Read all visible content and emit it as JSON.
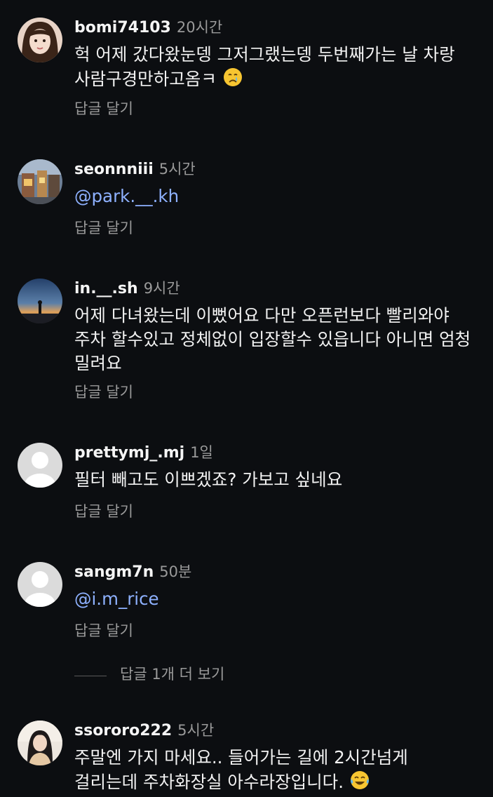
{
  "comments": [
    {
      "username": "bomi74103",
      "time": "20시간",
      "text": "헉 어제 갔다왔눈뎅 그저그랬는뎅 두번째가는 날 차랑 사람구경만하고옴ㅋ",
      "emoji": "crying-face",
      "reply_label": "답글 달기"
    },
    {
      "username": "seonnniii",
      "time": "5시간",
      "mention": "@park.__.kh",
      "reply_label": "답글 달기"
    },
    {
      "username": "in.__.sh",
      "time": "9시간",
      "text": "어제 다녀왔는데 이뻤어요 다만 오픈런보다 빨리와야 주차 할수있고 정체없이 입장할수 있읍니다 아니면 엄청 밀려요",
      "reply_label": "답글 달기"
    },
    {
      "username": "prettymj_.mj",
      "time": "1일",
      "text": "필터 빼고도 이쁘겠죠? 가보고 싶네요",
      "reply_label": "답글 달기"
    },
    {
      "username": "sangm7n",
      "time": "50분",
      "mention": "@i.m_rice",
      "reply_label": "답글 달기"
    },
    {
      "username": "ssororo222",
      "time": "5시간",
      "text": "주말엔 가지 마세요.. 들어가는 길에 2시간넘게 걸리는데 주차화장실 아수라장입니다.",
      "emoji": "tears-of-joy-face",
      "reply_label": "답글 달기"
    }
  ],
  "view_replies_label": "답글 1개 더 보기",
  "colors": {
    "background": "#0c0e11",
    "text": "#f2f2f2",
    "secondary": "#9a9a9a",
    "mention": "#8eb1ff"
  }
}
